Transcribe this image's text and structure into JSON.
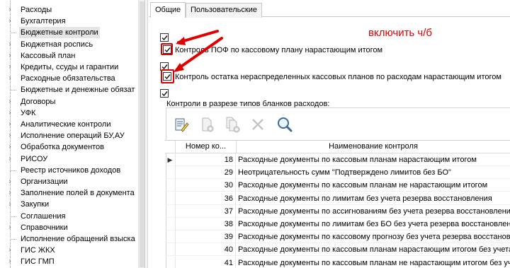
{
  "tree": {
    "items": [
      {
        "label": "Расходы",
        "expandable": true
      },
      {
        "label": "Бухгалтерия",
        "expandable": true
      },
      {
        "label": "Бюджетные контроли",
        "expandable": false,
        "selected": true
      },
      {
        "label": "Бюджетная роспись",
        "expandable": true
      },
      {
        "label": "Кассовый план",
        "expandable": true
      },
      {
        "label": "Кредиты, ссуды и гарантии",
        "expandable": true
      },
      {
        "label": "Расходные обязательства",
        "expandable": true
      },
      {
        "label": "Бюджетные и денежные обязат",
        "expandable": false
      },
      {
        "label": "Договоры",
        "expandable": true
      },
      {
        "label": "УФК",
        "expandable": true
      },
      {
        "label": "Аналитические контроли",
        "expandable": true
      },
      {
        "label": "Исполнение операций БУ,АУ",
        "expandable": true
      },
      {
        "label": "Обработка документов",
        "expandable": true
      },
      {
        "label": "РИСОУ",
        "expandable": true
      },
      {
        "label": "Реестр источников доходов",
        "expandable": false
      },
      {
        "label": "Организации",
        "expandable": true
      },
      {
        "label": "Заполнение полей в документа",
        "expandable": true
      },
      {
        "label": "Закупки",
        "expandable": true
      },
      {
        "label": "Соглашения",
        "expandable": false
      },
      {
        "label": "Справочники",
        "expandable": true
      },
      {
        "label": "Исполнение обращений взыска",
        "expandable": false
      },
      {
        "label": "ГИС ЖКХ",
        "expandable": true
      },
      {
        "label": "ГИС ГМП",
        "expandable": true
      }
    ]
  },
  "tabs": [
    {
      "label": "Общие",
      "active": true
    },
    {
      "label": "Пользовательские",
      "active": false
    }
  ],
  "settings": {
    "pof_control": {
      "label": "Контроль ПОФ по кассовому плану нарастающим итогом",
      "checked": true
    },
    "remainder_control": {
      "label": "Контроль остатка нераспределенных кассовых планов по расходам нарастающим итогом",
      "checked": true
    },
    "blank_types_control": {
      "label": "Контроли в разрезе типов бланков расходов:",
      "checked": true
    }
  },
  "annotation": {
    "text": "включить ч/б",
    "color": "#e00000"
  },
  "toolbar": {
    "buttons": [
      {
        "icon": "edit-icon",
        "enabled": true
      },
      {
        "icon": "new-document-icon",
        "enabled": false
      },
      {
        "icon": "copy-document-icon",
        "enabled": false
      },
      {
        "icon": "delete-icon",
        "enabled": false
      },
      {
        "icon": "search-icon",
        "enabled": true
      }
    ]
  },
  "grid": {
    "columns": [
      "Номер ко...",
      "Наименование контроля"
    ],
    "rows": [
      {
        "num": "18",
        "name": "Расходные документы по кассовым планам нарастающим итогом",
        "current": true
      },
      {
        "num": "29",
        "name": "Неотрицательность сумм \"Подтверждено лимитов без БО\"",
        "current": false
      },
      {
        "num": "30",
        "name": "Расходные документы по кассовым планам не нарастающим итогом",
        "current": false
      },
      {
        "num": "36",
        "name": "Расходные документы по лимитам без учета резерва восстановления",
        "current": false
      },
      {
        "num": "37",
        "name": "Расходные документы по ассигнованиям без учета резерва восстановления",
        "current": false
      },
      {
        "num": "38",
        "name": "Расходные документы по лимитам без БО без учета резерва восстановления",
        "current": false
      },
      {
        "num": "39",
        "name": "Расходные документы по кассовому прогнозу без учета резерва восстановления",
        "current": false
      },
      {
        "num": "40",
        "name": "Расходные документы по кассовым планам нарастающим итогом без учета резер",
        "current": false
      },
      {
        "num": "41",
        "name": "Расходные документы по кассовым планам не нарастающим итогом без учета резе",
        "current": false
      }
    ]
  }
}
